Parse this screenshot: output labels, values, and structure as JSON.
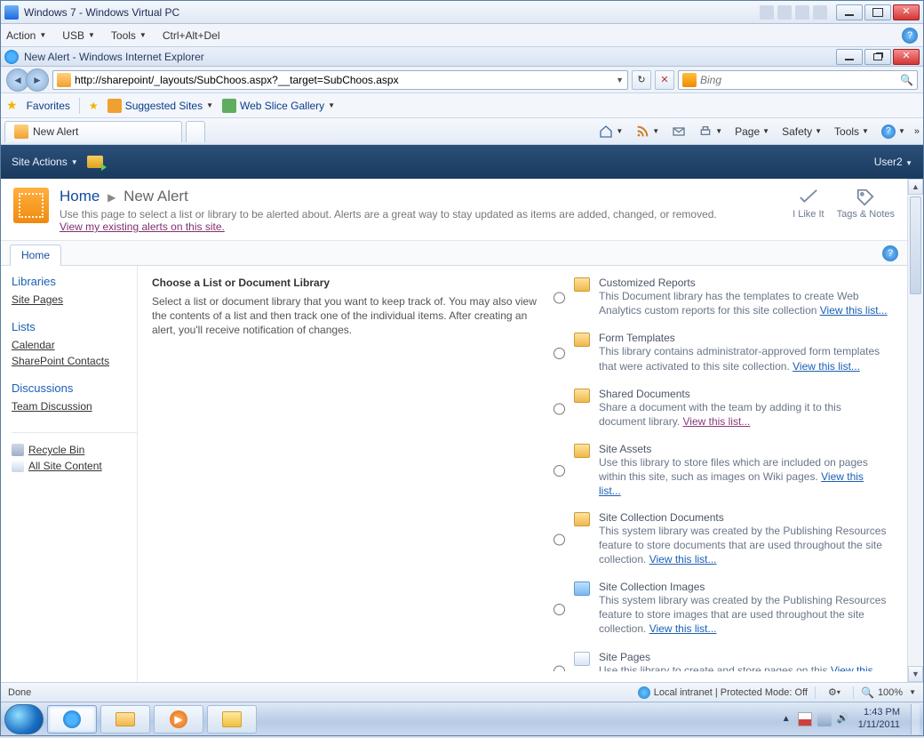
{
  "vm_window": {
    "title": "Windows 7 - Windows Virtual PC",
    "menu": {
      "action": "Action",
      "usb": "USB",
      "tools": "Tools",
      "cad": "Ctrl+Alt+Del"
    }
  },
  "ie_window": {
    "title": "New Alert - Windows Internet Explorer",
    "url_display": "http://sharepoint/_layouts/SubChoos.aspx?__target=SubChoos.aspx",
    "search_placeholder": "Bing",
    "favorites_label": "Favorites",
    "suggested_sites": "Suggested Sites",
    "web_slice": "Web Slice Gallery",
    "tab_title": "New Alert",
    "cmd": {
      "page": "Page",
      "safety": "Safety",
      "tools": "Tools"
    },
    "status": {
      "done": "Done",
      "zone": "Local intranet | Protected Mode: Off",
      "zoom": "100%"
    }
  },
  "sharepoint": {
    "site_actions": "Site Actions",
    "user": "User2",
    "breadcrumb_home": "Home",
    "breadcrumb_current": "New Alert",
    "description": "Use this page to select a list or library to be alerted about. Alerts are a great way to stay updated as items are added, changed, or removed.",
    "existing_link": "View my existing alerts on this site.",
    "social": {
      "like": "I Like It",
      "tags": "Tags & Notes"
    },
    "home_tab": "Home",
    "leftnav": {
      "libraries_h": "Libraries",
      "site_pages": "Site Pages",
      "lists_h": "Lists",
      "calendar": "Calendar",
      "contacts": "SharePoint Contacts",
      "discussions_h": "Discussions",
      "team_discussion": "Team Discussion",
      "recycle": "Recycle Bin",
      "all_content": "All Site Content"
    },
    "choose": {
      "heading": "Choose a List or Document Library",
      "text": "Select a list or document library that you want to keep track of. You may also view the contents of a list and then track one of the individual items. After creating an alert, you'll receive notification of changes."
    },
    "view_this_list": "View this list...",
    "lists": [
      {
        "title": "Customized Reports",
        "desc": "This Document library has the templates to create Web Analytics custom reports for this site collection ",
        "icon": "folder",
        "visited": false
      },
      {
        "title": "Form Templates",
        "desc": "This library contains administrator-approved form templates that were activated to this site collection. ",
        "icon": "folder",
        "visited": false
      },
      {
        "title": "Shared Documents",
        "desc": "Share a document with the team by adding it to this document library. ",
        "icon": "folder",
        "visited": true
      },
      {
        "title": "Site Assets",
        "desc": "Use this library to store files which are included on pages within this site, such as images on Wiki pages. ",
        "icon": "folder",
        "visited": false
      },
      {
        "title": "Site Collection Documents",
        "desc": "This system library was created by the Publishing Resources feature to store documents that are used throughout the site collection. ",
        "icon": "folder",
        "visited": false
      },
      {
        "title": "Site Collection Images",
        "desc": "This system library was created by the Publishing Resources feature to store images that are used throughout the site collection. ",
        "icon": "img",
        "visited": false
      },
      {
        "title": "Site Pages",
        "desc": "Use this library to create and store pages on this ",
        "icon": "page",
        "visited": false
      }
    ]
  },
  "taskbar": {
    "time": "1:43 PM",
    "date": "1/11/2011"
  }
}
